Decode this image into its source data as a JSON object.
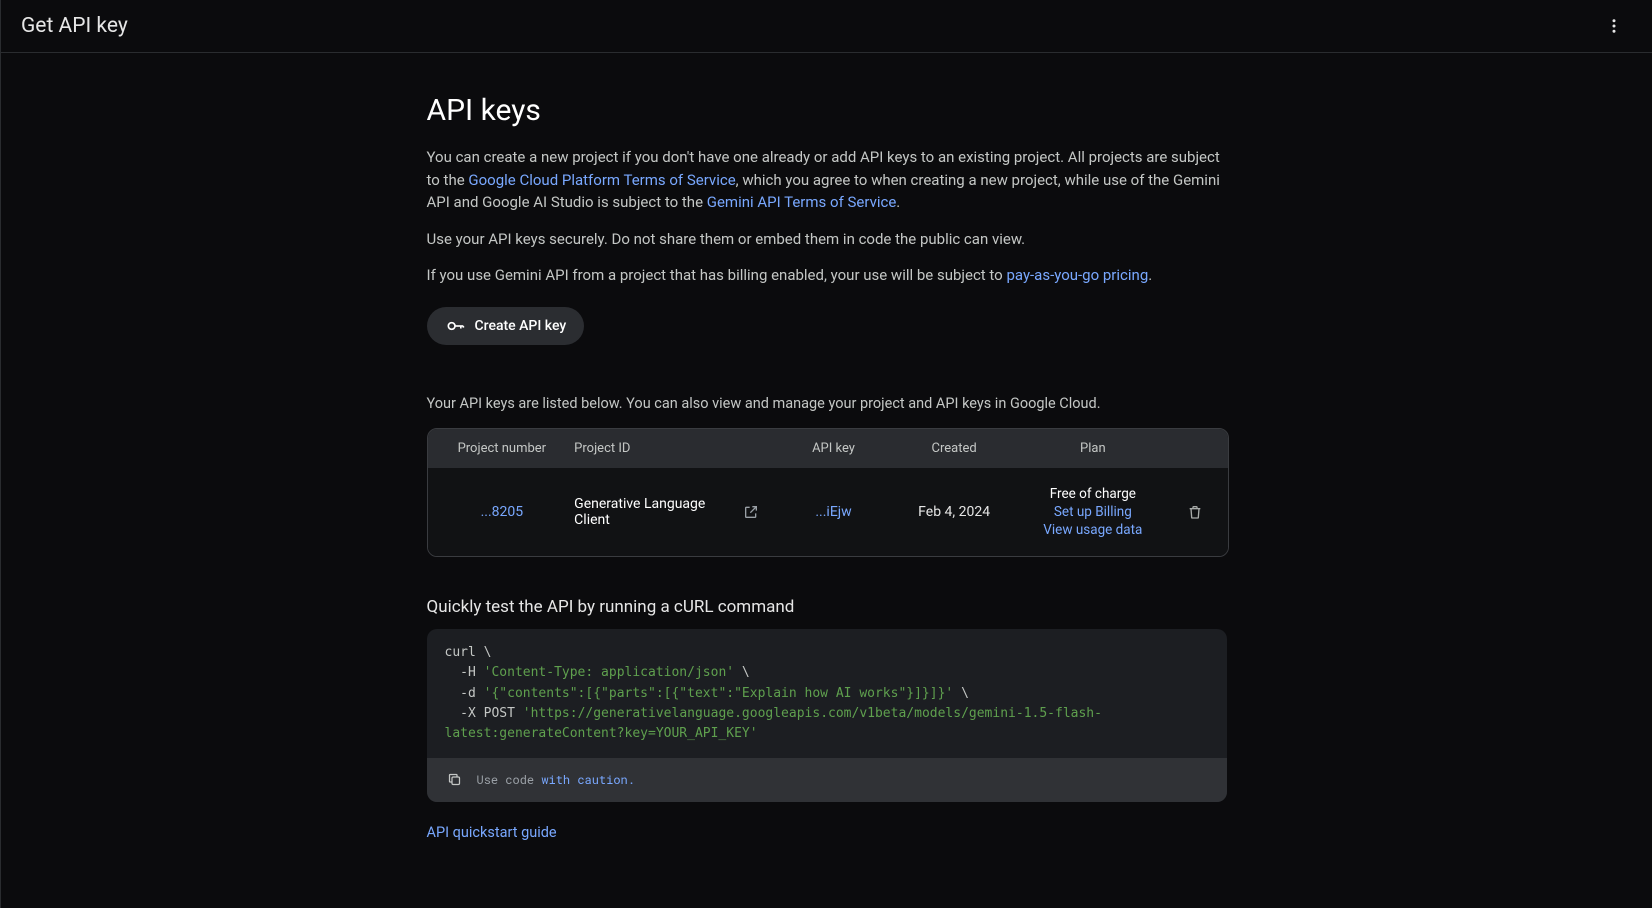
{
  "header": {
    "title": "Get API key"
  },
  "main": {
    "heading": "API keys",
    "intro": {
      "part1": "You can create a new project if you don't have one already or add API keys to an existing project. All projects are subject to the ",
      "link1": "Google Cloud Platform Terms of Service",
      "part2": ", which you agree to when creating a new project, while use of the Gemini API and Google AI Studio is subject to the ",
      "link2": "Gemini API Terms of Service",
      "part3": "."
    },
    "security_note": "Use your API keys securely. Do not share them or embed them in code the public can view.",
    "billing": {
      "part1": "If you use Gemini API from a project that has billing enabled, your use will be subject to ",
      "link": "pay-as-you-go pricing",
      "part2": "."
    },
    "create_button_label": "Create API key",
    "list_intro": "Your API keys are listed below. You can also view and manage your project and API keys in Google Cloud."
  },
  "table": {
    "headers": {
      "project_number": "Project number",
      "project_id": "Project ID",
      "api_key": "API key",
      "created": "Created",
      "plan": "Plan"
    },
    "rows": [
      {
        "project_number": "...8205",
        "project_id": "Generative Language Client",
        "api_key": "...iEjw",
        "created": "Feb 4, 2024",
        "plan_free": "Free of charge",
        "plan_setup": "Set up Billing",
        "plan_usage": "View usage data"
      }
    ]
  },
  "curl_section": {
    "heading": "Quickly test the API by running a cURL command",
    "code": {
      "l1a": "curl \\",
      "l2a": "  -H ",
      "l2b": "'Content-Type: application/json'",
      "l2c": " \\",
      "l3a": "  -d ",
      "l3b": "'{\"contents\":[{\"parts\":[{\"text\":\"Explain how AI works\"}]}]}'",
      "l3c": " \\",
      "l4a": "  -X POST ",
      "l4b": "'https://generativelanguage.googleapis.com/v1beta/models/gemini-1.5-flash-latest:generateContent?key=YOUR_API_KEY'"
    },
    "footer_prefix": "Use code ",
    "footer_link": "with caution."
  },
  "quickstart_link": "API quickstart guide"
}
